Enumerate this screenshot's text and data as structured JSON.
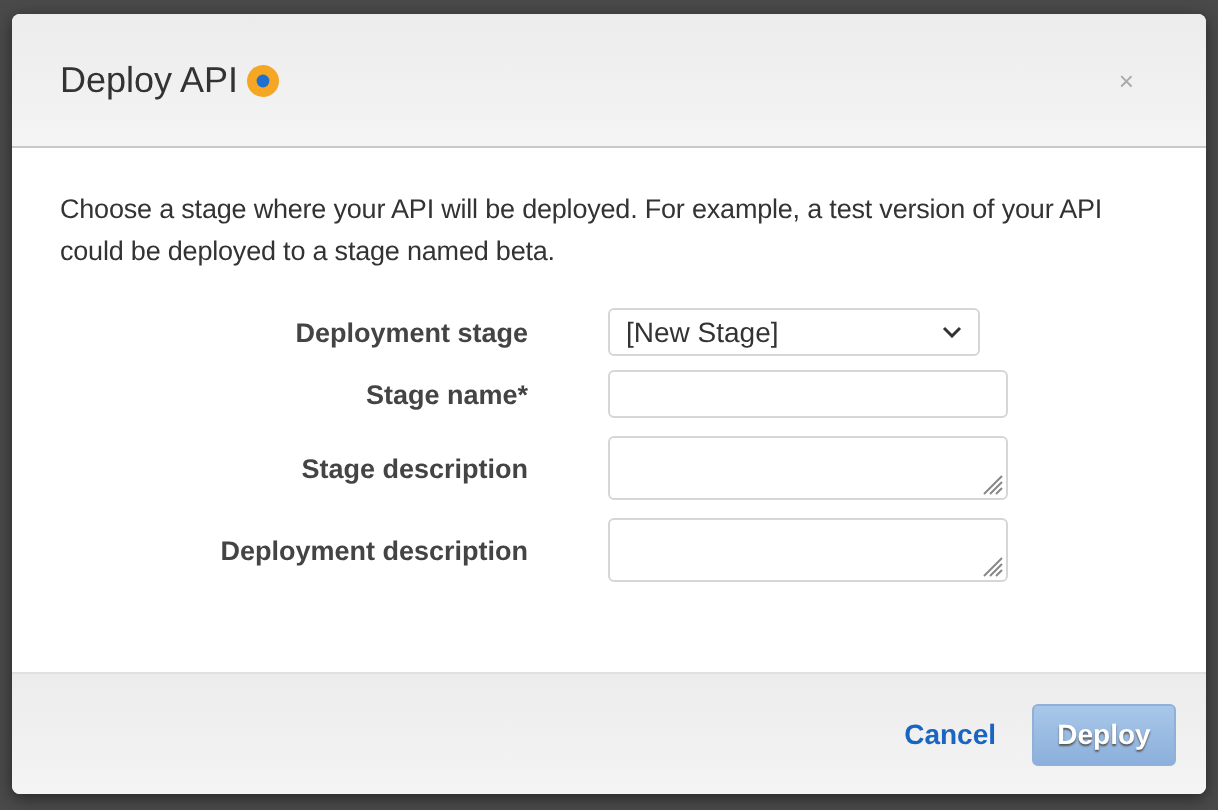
{
  "dialog": {
    "title": "Deploy API",
    "close": "×",
    "description": "Choose a stage where your API will be deployed. For example, a test version of your API could be deployed to a stage named beta.",
    "fields": [
      {
        "kind": "select",
        "label": "Deployment stage",
        "value": "[New Stage]"
      },
      {
        "kind": "text",
        "label": "Stage name*"
      },
      {
        "kind": "textarea",
        "label": "Stage description"
      },
      {
        "kind": "textarea",
        "label": "Deployment description"
      }
    ],
    "cancel": "Cancel",
    "deploy": {
      "label": "Deploy",
      "disabled": true
    }
  }
}
